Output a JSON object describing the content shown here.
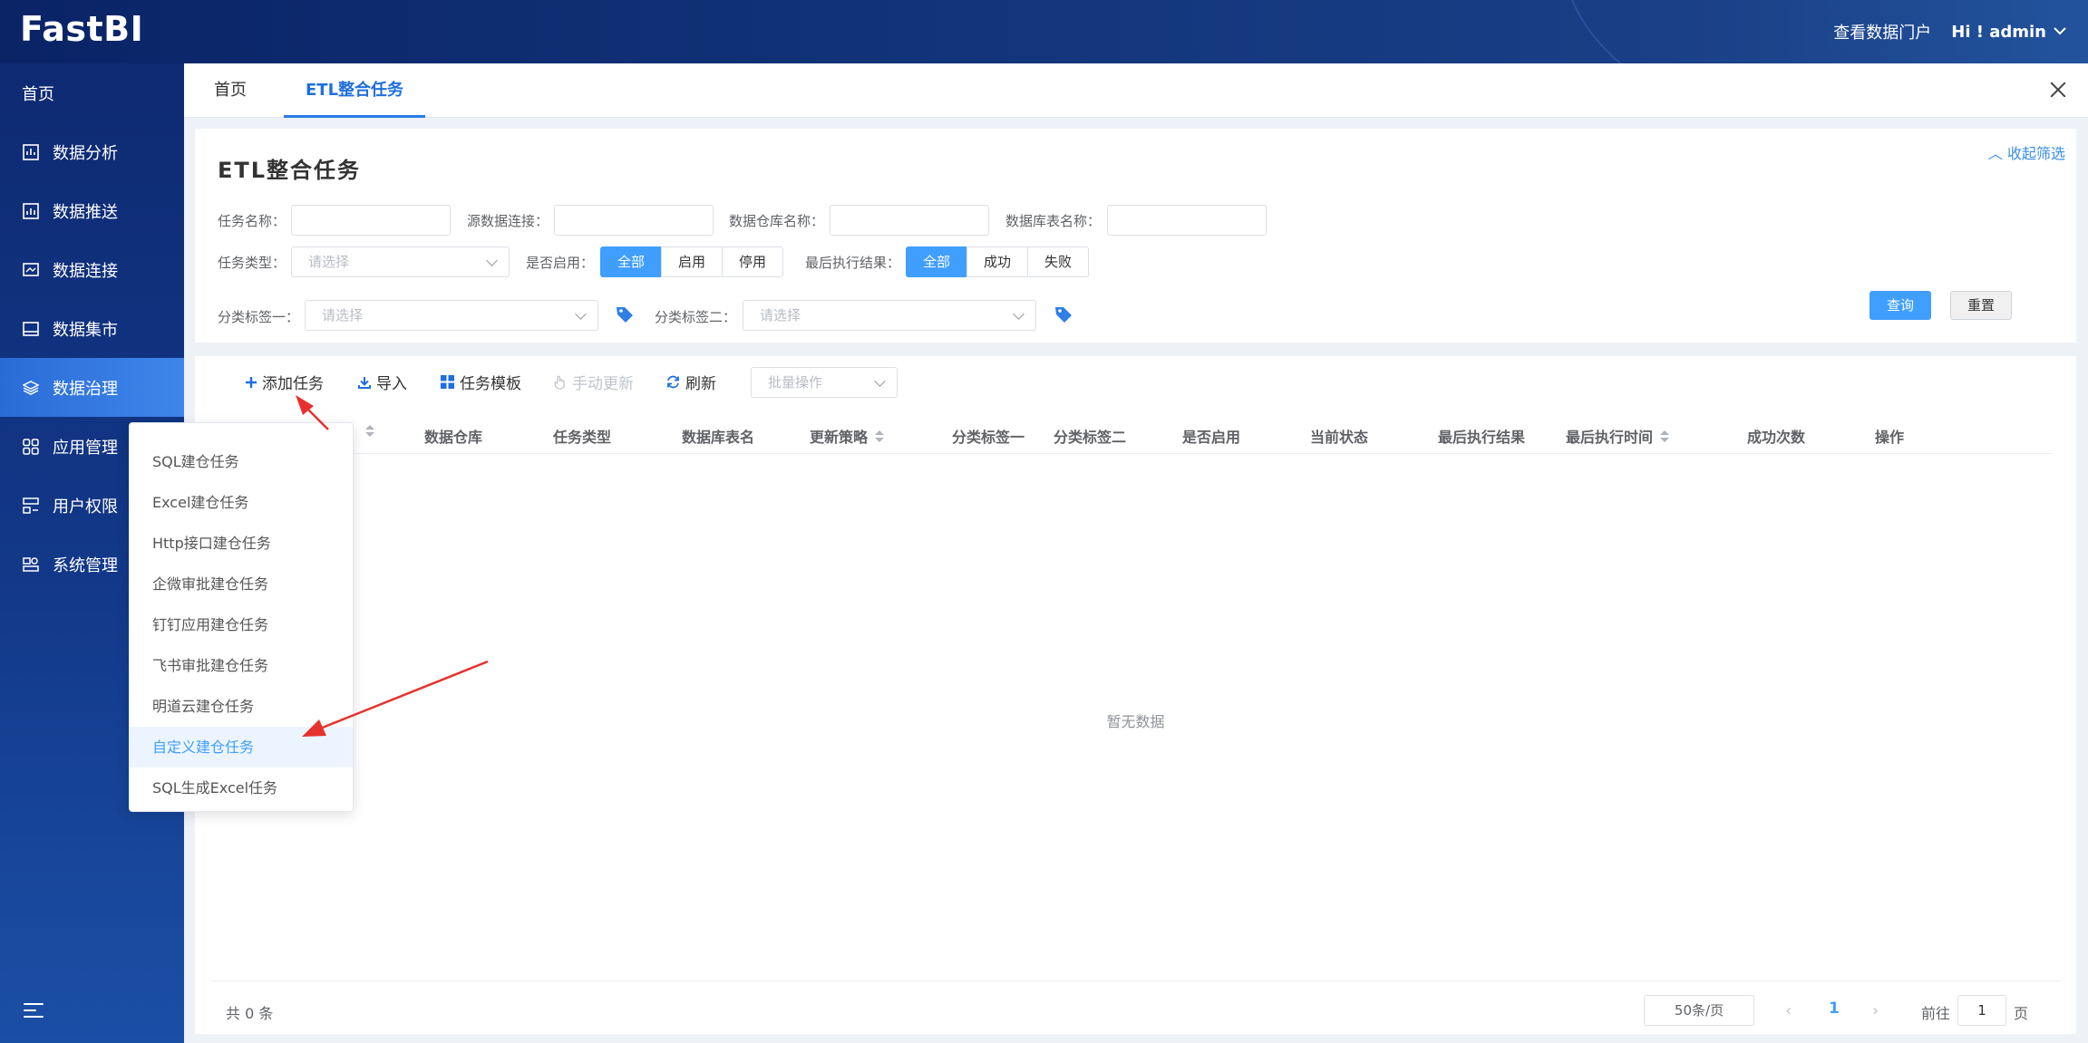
{
  "app": {
    "logo": "FastBI",
    "portal_link": "查看数据门户",
    "user": "Hi ! admin"
  },
  "sidebar": {
    "home": "首页",
    "items": [
      {
        "label": "数据分析",
        "icon": "analysis-icon"
      },
      {
        "label": "数据推送",
        "icon": "push-icon"
      },
      {
        "label": "数据连接",
        "icon": "connection-icon"
      },
      {
        "label": "数据集市",
        "icon": "datamart-icon"
      },
      {
        "label": "数据治理",
        "icon": "governance-icon",
        "active": true
      },
      {
        "label": "应用管理",
        "icon": "apps-icon"
      },
      {
        "label": "用户权限",
        "icon": "users-icon"
      },
      {
        "label": "系统管理",
        "icon": "system-icon"
      }
    ]
  },
  "tabs": [
    {
      "label": "首页"
    },
    {
      "label": "ETL整合任务",
      "active": true
    }
  ],
  "filter": {
    "title": "ETL整合任务",
    "collapse": "收起筛选",
    "task_name": "任务名称：",
    "source_conn": "源数据连接：",
    "warehouse_name": "数据仓库名称：",
    "table_name": "数据库表名称：",
    "task_type": "任务类型：",
    "task_type_placeholder": "请选择",
    "enabled": "是否启用：",
    "enabled_options": [
      "全部",
      "启用",
      "停用"
    ],
    "last_result": "最后执行结果：",
    "last_result_options": [
      "全部",
      "成功",
      "失败"
    ],
    "tag1": "分类标签一：",
    "tag1_placeholder": "请选择",
    "tag2": "分类标签二：",
    "tag2_placeholder": "请选择",
    "query": "查询",
    "reset": "重置"
  },
  "toolbar": {
    "add": "添加任务",
    "import": "导入",
    "template": "任务模板",
    "manual_update": "手动更新",
    "refresh": "刷新",
    "batch": "批量操作"
  },
  "table": {
    "columns": [
      "数据仓库",
      "任务类型",
      "数据库表名",
      "更新策略",
      "分类标签一",
      "分类标签二",
      "是否启用",
      "当前状态",
      "最后执行结果",
      "最后执行时间",
      "成功次数",
      "操作"
    ],
    "empty": "暂无数据"
  },
  "pagination": {
    "total": "共 0 条",
    "page_size": "50条/页",
    "current": "1",
    "goto": "前往",
    "goto_value": "1",
    "unit": "页"
  },
  "add_menu": [
    "SQL建仓任务",
    "Excel建仓任务",
    "Http接口建仓任务",
    "企微审批建仓任务",
    "钉钉应用建仓任务",
    "飞书审批建仓任务",
    "明道云建仓任务",
    "自定义建仓任务",
    "SQL生成Excel任务"
  ],
  "colors": {
    "accent": "#409eff",
    "sidebar": "#13398a",
    "annotation": "#e5322d"
  }
}
